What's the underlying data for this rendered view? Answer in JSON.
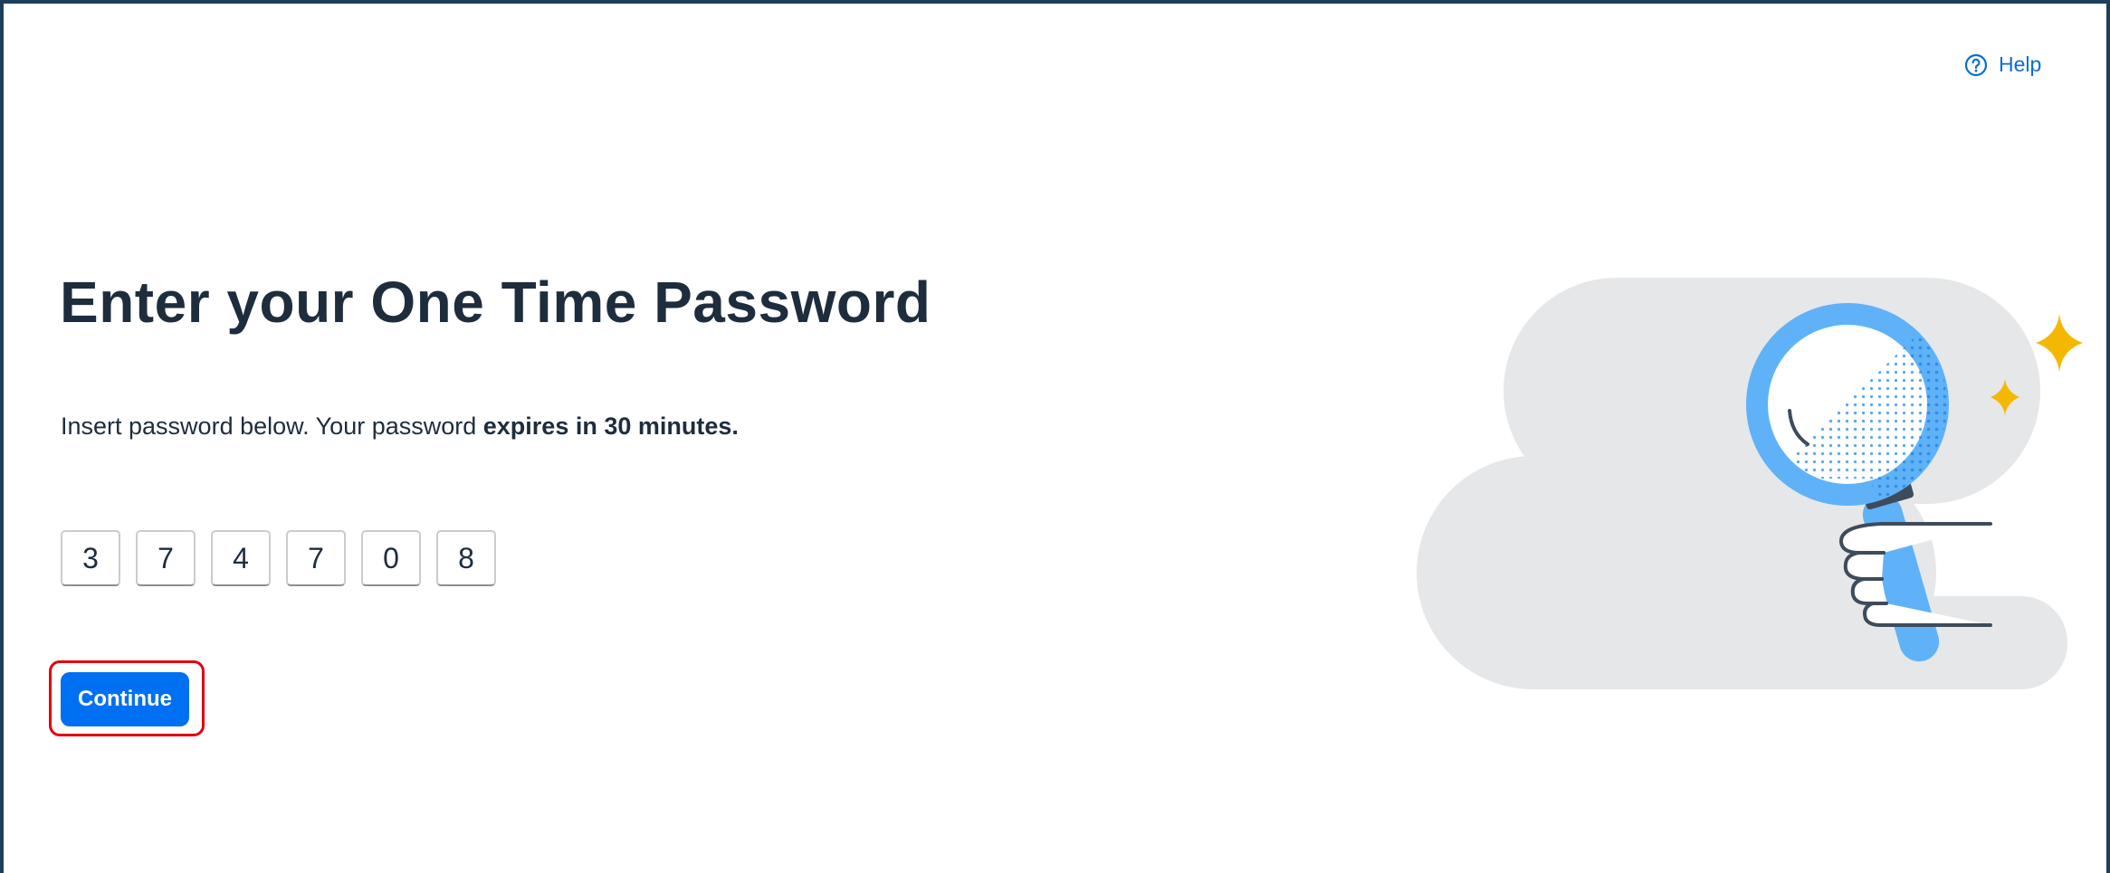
{
  "header": {
    "help_label": "Help",
    "help_icon": "question-circle-icon"
  },
  "main": {
    "title": "Enter your One Time Password",
    "subtitle_prefix": "Insert password below. Your password ",
    "subtitle_bold": "expires in 30 minutes.",
    "otp_digits": [
      "3",
      "7",
      "4",
      "7",
      "0",
      "8"
    ],
    "continue_label": "Continue"
  },
  "illustration": {
    "icon": "magnifying-glass-illustration"
  },
  "colors": {
    "frame_border": "#1d3f5e",
    "accent": "#0070f2",
    "link": "#0a6ed1",
    "text": "#1d2d3e",
    "highlight": "#e00010",
    "sparkle": "#f5b800"
  }
}
